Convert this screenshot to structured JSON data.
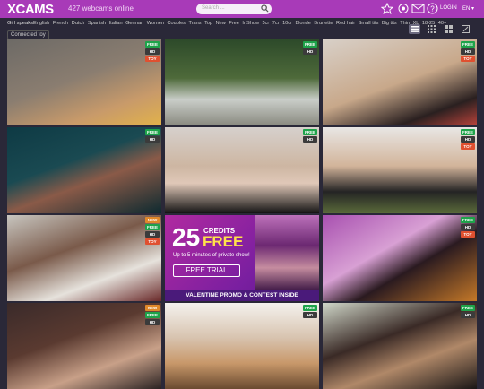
{
  "header": {
    "logo": "XCAMS",
    "online": "427 webcams online",
    "search_placeholder": "Search ...",
    "login": "LOGIN",
    "lang": "EN"
  },
  "filters": {
    "label": "Girl speaks:",
    "items": [
      "English",
      "French",
      "Dutch",
      "Spanish",
      "Italian",
      "German",
      "Women",
      "Couples",
      "Trans",
      "Top",
      "New",
      "Free",
      "InShow",
      "5cr",
      "7cr",
      "10cr",
      "Blonde",
      "Brunette",
      "Red hair",
      "Small tits",
      "Big tits",
      "Thin",
      "XL",
      "18-25",
      "40+"
    ]
  },
  "connected": "Connected toy",
  "colors": {
    "accent": "#a83ab8",
    "free": "#1ea34a",
    "new": "#e0882a",
    "toy": "#e05030"
  },
  "tiles": [
    {
      "badges": [
        "FREE",
        "HD",
        "TOY"
      ]
    },
    {
      "badges": [
        "FREE",
        "HD"
      ]
    },
    {
      "badges": [
        "FREE",
        "HD",
        "TOY"
      ]
    },
    {
      "badges": [
        "FREE",
        "HD"
      ]
    },
    {
      "badges": [
        "FREE",
        "HD"
      ]
    },
    {
      "badges": [
        "FREE",
        "HD",
        "TOY"
      ]
    },
    {
      "badges": [
        "NEW",
        "FREE",
        "HD",
        "TOY"
      ]
    },
    {
      "promo": true
    },
    {
      "badges": [
        "FREE",
        "HD",
        "TOY"
      ]
    },
    {
      "badges": [
        "NEW",
        "FREE",
        "HD"
      ]
    },
    {
      "badges": [
        "FREE",
        "HD"
      ]
    },
    {
      "badges": [
        "FREE",
        "HD"
      ]
    }
  ],
  "promo": {
    "big": "25",
    "credits": "CREDITS",
    "free": "FREE",
    "sub": "Up to 5 minutes of private show!",
    "button": "FREE TRIAL",
    "footer": "VALENTINE PROMO & CONTEST INSIDE"
  }
}
